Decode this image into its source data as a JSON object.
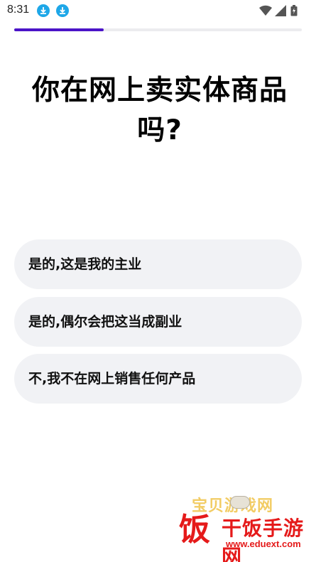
{
  "status_bar": {
    "time": "8:31",
    "icons": [
      "download-icon",
      "download-icon",
      "wifi-icon",
      "signal-icon",
      "battery-icon"
    ]
  },
  "progress": {
    "fraction": 0.31,
    "color": "#4b14c8"
  },
  "question": "你在网上卖实体商品吗?",
  "options": [
    {
      "label": "是的,这是我的主业"
    },
    {
      "label": "是的,偶尔会把这当成副业"
    },
    {
      "label": "不,我不在网上销售任何产品"
    }
  ],
  "watermark": {
    "big_char": "饭",
    "top_text": "宝贝游戏网",
    "title": "干饭手游网",
    "url": "www.eduext.com"
  }
}
